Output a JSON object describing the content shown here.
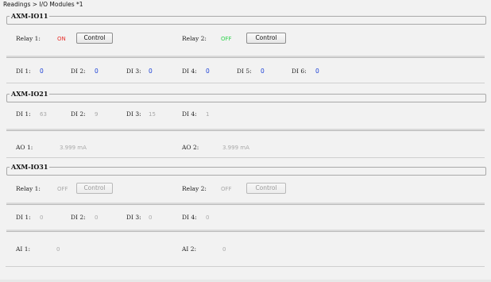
{
  "breadcrumb": "Readings > I/O Modules *1",
  "modules": [
    {
      "title": "AXM-IO11",
      "relays": [
        {
          "label": "Relay 1:",
          "state": "ON",
          "button": "Control"
        },
        {
          "label": "Relay 2:",
          "state": "OFF",
          "button": "Control"
        }
      ],
      "di": [
        {
          "label": "DI 1:",
          "value": "0"
        },
        {
          "label": "DI 2:",
          "value": "0"
        },
        {
          "label": "DI 3:",
          "value": "0"
        },
        {
          "label": "DI 4:",
          "value": "0"
        },
        {
          "label": "DI 5:",
          "value": "0"
        },
        {
          "label": "DI 6:",
          "value": "0"
        }
      ]
    },
    {
      "title": "AXM-IO21",
      "di": [
        {
          "label": "DI 1:",
          "value": "63"
        },
        {
          "label": "DI 2:",
          "value": "9"
        },
        {
          "label": "DI 3:",
          "value": "15"
        },
        {
          "label": "DI 4:",
          "value": "1"
        }
      ],
      "ao": [
        {
          "label": "AO 1:",
          "value": "3.999 mA"
        },
        {
          "label": "AO 2:",
          "value": "3.999 mA"
        }
      ]
    },
    {
      "title": "AXM-IO31",
      "relays": [
        {
          "label": "Relay 1:",
          "state": "OFF",
          "button": "Control"
        },
        {
          "label": "Relay 2:",
          "state": "OFF",
          "button": "Control"
        }
      ],
      "di": [
        {
          "label": "DI 1:",
          "value": "0"
        },
        {
          "label": "DI 2:",
          "value": "0"
        },
        {
          "label": "DI 3:",
          "value": "0"
        },
        {
          "label": "DI 4:",
          "value": "0"
        }
      ],
      "ai": [
        {
          "label": "AI 1:",
          "value": "0"
        },
        {
          "label": "AI 2:",
          "value": "0"
        }
      ]
    }
  ],
  "colors": {
    "on": "#e8322d",
    "off_active": "#2fd34d",
    "value_blue": "#1a3fd6",
    "value_gray": "#a9a9a9"
  }
}
